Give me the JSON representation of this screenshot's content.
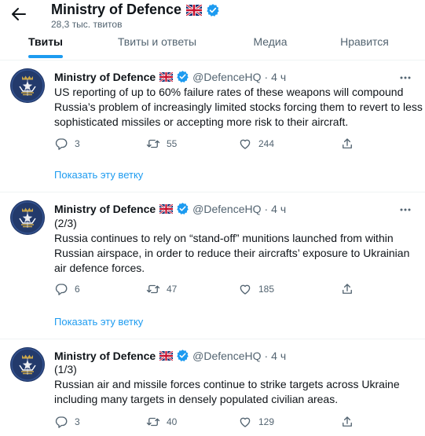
{
  "profile": {
    "name": "Ministry of Defence",
    "tweet_count": "28,3 тыс. твитов"
  },
  "tabs": [
    {
      "label": "Твиты",
      "active": true
    },
    {
      "label": "Твиты и ответы",
      "active": false
    },
    {
      "label": "Медиа",
      "active": false
    },
    {
      "label": "Нравится",
      "active": false
    }
  ],
  "tweets": [
    {
      "author": "Ministry of Defence",
      "handle": "@DefenceHQ",
      "time": "4 ч",
      "lines": [
        "US reporting of up to 60% failure rates of these weapons will compound",
        "Russia’s problem of increasingly limited stocks forcing them to revert to less",
        "sophisticated missiles or accepting more risk to their aircraft."
      ],
      "replies": "3",
      "retweets": "55",
      "likes": "244",
      "show_thread": "Показать эту ветку"
    },
    {
      "author": "Ministry of Defence",
      "handle": "@DefenceHQ",
      "time": "4 ч",
      "lines": [
        "(2/3)",
        "Russia continues to rely on “stand-off” munitions launched from within",
        "Russian airspace, in order to reduce their aircrafts’ exposure to Ukrainian",
        "air defence forces."
      ],
      "replies": "6",
      "retweets": "47",
      "likes": "185",
      "show_thread": "Показать эту ветку"
    },
    {
      "author": "Ministry of Defence",
      "handle": "@DefenceHQ",
      "time": "4 ч",
      "lines": [
        "(1/3)",
        "Russian air and missile forces continue to strike targets across Ukraine",
        "including many targets in densely populated civilian areas."
      ],
      "replies": "3",
      "retweets": "40",
      "likes": "129"
    }
  ],
  "colors": {
    "accent": "#1d9bf0",
    "secondary_text": "#536471",
    "avatar_bg": "#233a6b",
    "crest_gold": "#c9a64a"
  },
  "icons": {
    "back": "arrow-left-icon",
    "verified": "verified-badge-icon",
    "flag": "uk-flag-icon",
    "more": "more-dots-icon",
    "reply": "reply-icon",
    "retweet": "retweet-icon",
    "like": "heart-icon",
    "share": "share-icon"
  }
}
